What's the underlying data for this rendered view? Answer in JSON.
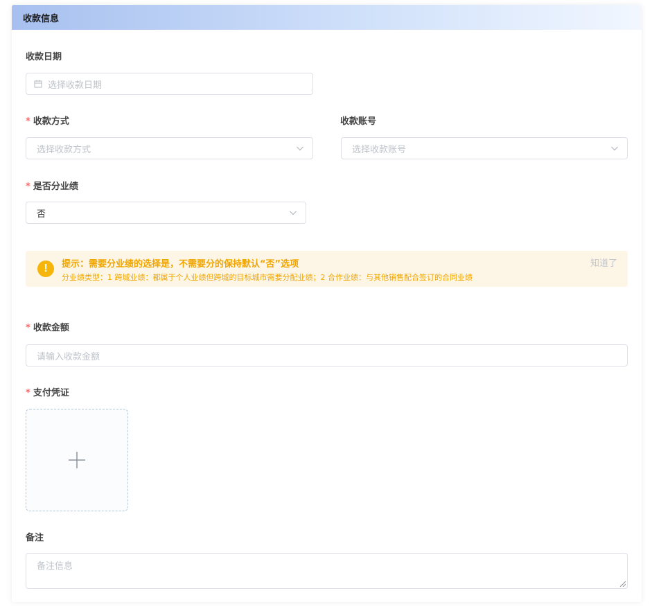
{
  "section": {
    "title": "收款信息"
  },
  "payment_date": {
    "label": "收款日期",
    "placeholder": "选择收款日期",
    "icon": "calendar-icon"
  },
  "payment_method": {
    "required_mark": "*",
    "label": "收款方式",
    "placeholder": "选择收款方式",
    "icon": "chevron-down-icon"
  },
  "payment_account": {
    "label": "收款账号",
    "placeholder": "选择收款账号",
    "icon": "chevron-down-icon"
  },
  "split_performance": {
    "required_mark": "*",
    "label": "是否分业绩",
    "value": "否",
    "icon": "chevron-down-icon"
  },
  "tip": {
    "icon": "warning-icon",
    "icon_glyph": "!",
    "title": "提示：需要分业绩的选择是，不需要分的保持默认“否”选项",
    "description": "分业绩类型：1 跨城业绩：都属于个人业绩但跨城的目标城市需要分配业绩；2 合作业绩：与其他销售配合签订的合同业绩",
    "close_label": "知道了",
    "color": "#f0a500"
  },
  "amount": {
    "required_mark": "*",
    "label": "收款金额",
    "placeholder": "请输入收款金额"
  },
  "voucher": {
    "required_mark": "*",
    "label": "支付凭证",
    "icon": "plus-icon"
  },
  "remark": {
    "label": "备注",
    "placeholder": "备注信息"
  },
  "colors": {
    "header_gradient_start": "#a7c0ef",
    "required": "#f56c6c",
    "border": "#dcdfe6",
    "placeholder": "#bfc3cb"
  }
}
